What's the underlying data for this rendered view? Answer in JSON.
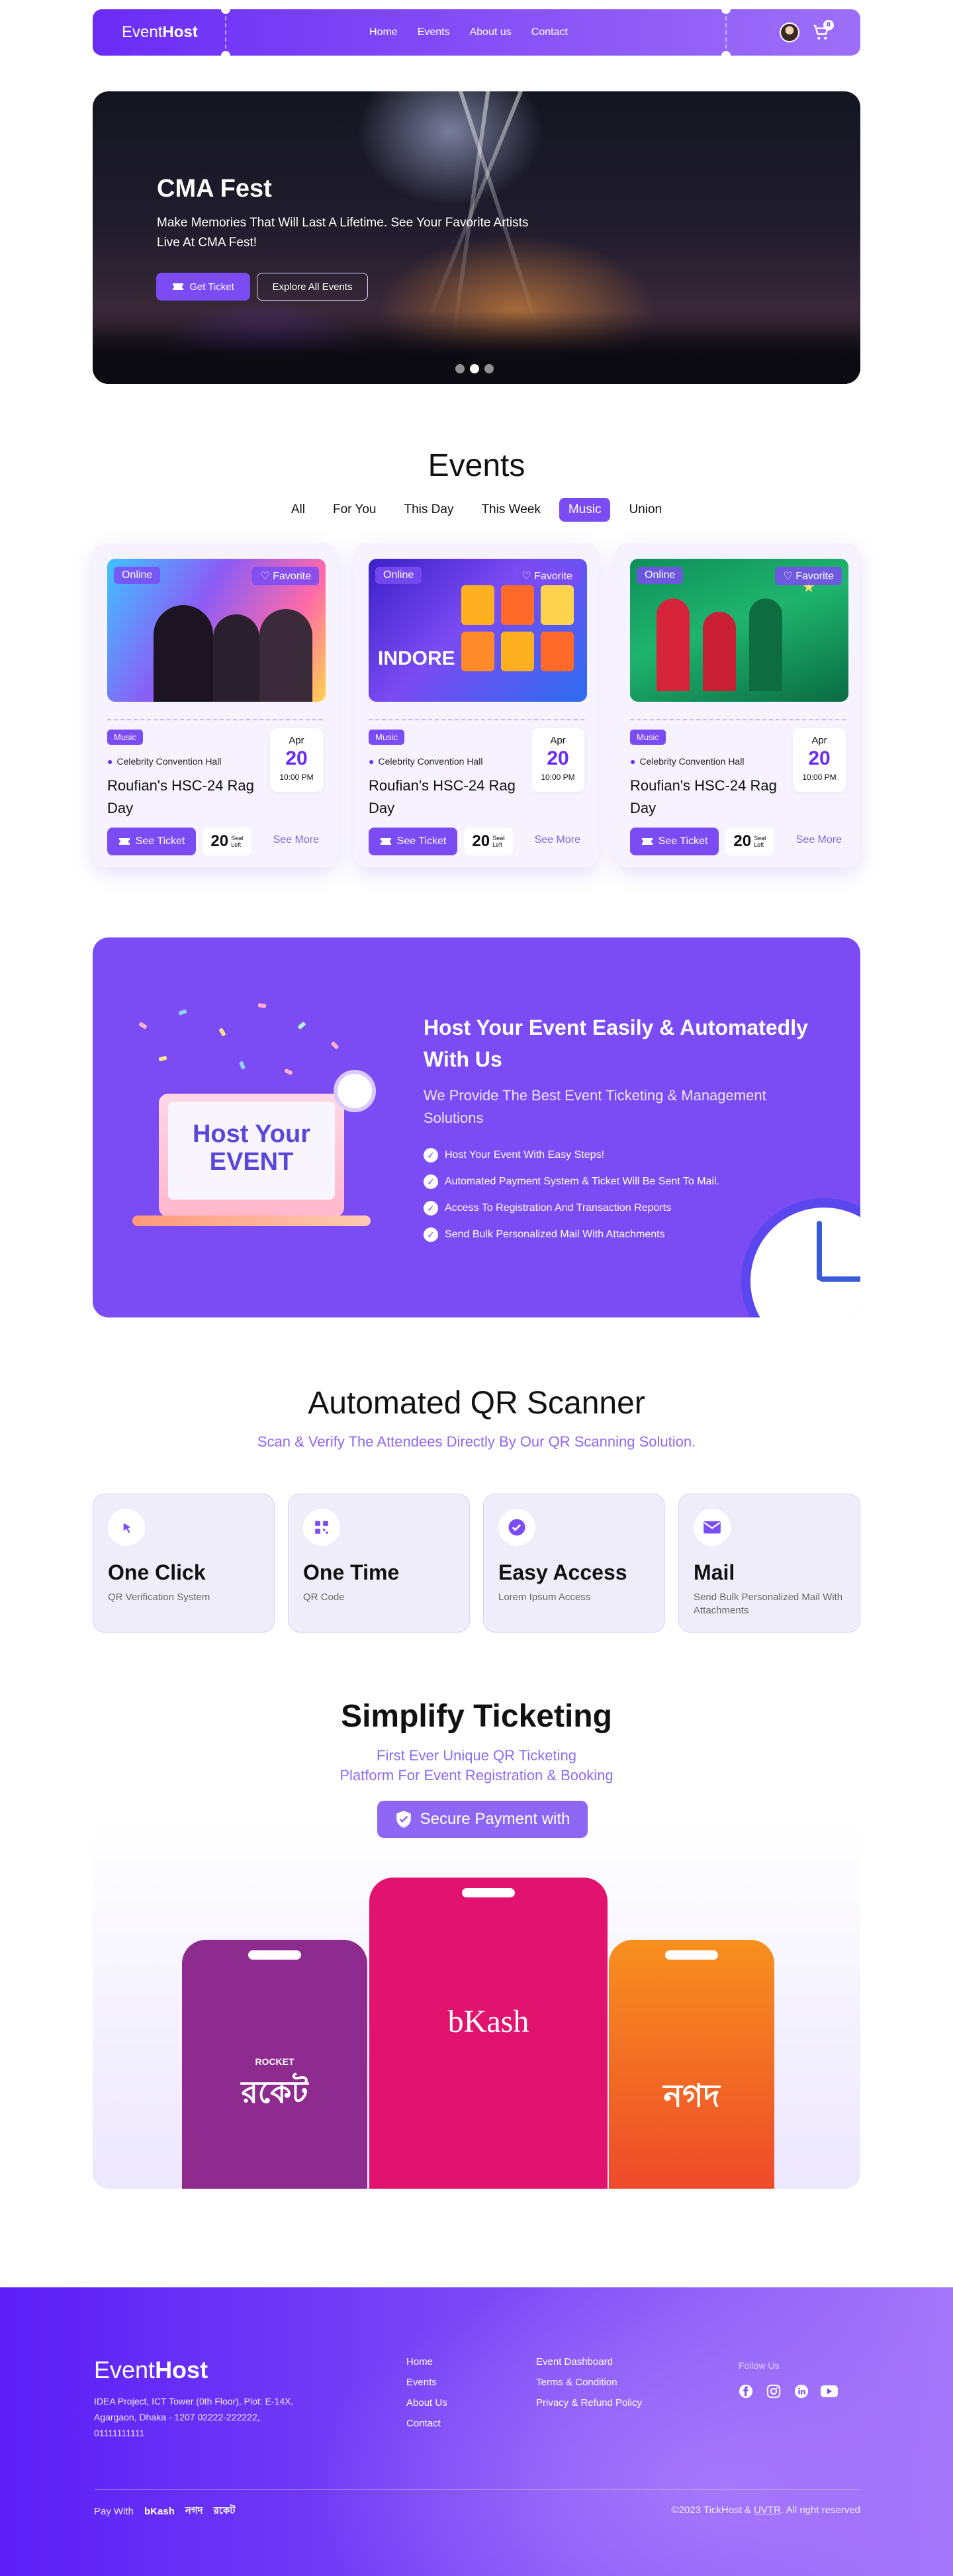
{
  "nav": {
    "logo_a": "Event",
    "logo_b": "Host",
    "links": [
      "Home",
      "Events",
      "About us",
      "Contact"
    ],
    "cart_count": "0"
  },
  "hero": {
    "title": "CMA Fest",
    "subtitle": "Make Memories That Will Last A Lifetime. See Your Favorite Artists Live At CMA Fest!",
    "get_ticket": "Get Ticket",
    "explore": "Explore All Events",
    "slides": 3,
    "active_slide": 2
  },
  "events": {
    "title": "Events",
    "filters": [
      "All",
      "For You",
      "This Day",
      "This Week",
      "Music",
      "Union"
    ],
    "active_filter": "Music",
    "cards": [
      {
        "badge": "Online",
        "favorite": "Favorite",
        "tag": "Music",
        "venue": "Celebrity Convention Hall",
        "title": "Roufian's HSC-24 Rag Day",
        "month": "Apr",
        "day": "20",
        "time": "10:00 PM",
        "see_ticket": "See Ticket",
        "seats": "20",
        "seat_label_a": "Seat",
        "seat_label_b": "Left",
        "see_more": "See More"
      },
      {
        "badge": "Online",
        "favorite": "Favorite",
        "tag": "Music",
        "venue": "Celebrity Convention Hall",
        "title": "Roufian's HSC-24 Rag Day",
        "month": "Apr",
        "day": "20",
        "time": "10:00 PM",
        "see_ticket": "See Ticket",
        "seats": "20",
        "seat_label_a": "Seat",
        "seat_label_b": "Left",
        "see_more": "See More"
      },
      {
        "badge": "Online",
        "favorite": "Favorite",
        "tag": "Music",
        "venue": "Celebrity Convention Hall",
        "title": "Roufian's HSC-24 Rag Day",
        "month": "Apr",
        "day": "20",
        "time": "10:00 PM",
        "see_ticket": "See Ticket",
        "seats": "20",
        "seat_label_a": "Seat",
        "seat_label_b": "Left",
        "see_more": "See More"
      }
    ]
  },
  "host": {
    "title": "Host Your Event Easily & Automatedly With Us",
    "subtitle": "We Provide The Best Event Ticketing & Management Solutions",
    "illustration_a": "Host Your",
    "illustration_b": "EVENT",
    "features": [
      "Host Your Event With Easy Steps!",
      "Automated Payment System & Ticket Will Be Sent To Mail.",
      "Access To Registration And Transaction Reports",
      "Send Bulk Personalized Mail With Attachments"
    ]
  },
  "qr": {
    "title": "Automated QR Scanner",
    "subtitle": "Scan & Verify The Attendees Directly By Our QR Scanning Solution.",
    "features": [
      {
        "title": "One Click",
        "desc": "QR Verification System",
        "icon": "pointer-click-icon"
      },
      {
        "title": "One Time",
        "desc": "QR Code",
        "icon": "qr-code-icon"
      },
      {
        "title": "Easy Access",
        "desc": "Lorem Ipsum Access",
        "icon": "check-badge-icon"
      },
      {
        "title": "Mail",
        "desc": "Send Bulk Personalized Mail With Attachments",
        "icon": "mail-icon"
      }
    ]
  },
  "simplify": {
    "title": "Simplify Ticketing",
    "subtitle_a": "First Ever Unique  QR Ticketing",
    "subtitle_b": "Platform For Event Registration & Booking",
    "secure": "Secure Payment with",
    "wallets": [
      {
        "name": "ROCKET",
        "label": "রকেট",
        "color": "#8e2b8f"
      },
      {
        "name": "bKash",
        "label": "bKash",
        "color": "#e2136e"
      },
      {
        "name": "Nagad",
        "label": "নগদ",
        "color": "#f06a24"
      }
    ]
  },
  "footer": {
    "logo_a": "Event",
    "logo_b": "Host",
    "address": "IDEA Project, ICT Tower (0th Floor), Plot: E-14X, Agargaon, Dhaka - 1207 02222-222222, 01111111111",
    "col1": [
      "Home",
      "Events",
      "About Us",
      "Contact"
    ],
    "col2": [
      "Event Dashboard",
      "Terms & Condition",
      "Privacy & Refund Policy"
    ],
    "follow": "Follow Us",
    "pay_with": "Pay With",
    "pay_logos": [
      "bKash",
      "নগদ",
      "রকেট"
    ],
    "copyright_a": "©2023 TickHost & ",
    "copyright_link": "UVTR",
    "copyright_b": ". All right reserved"
  }
}
